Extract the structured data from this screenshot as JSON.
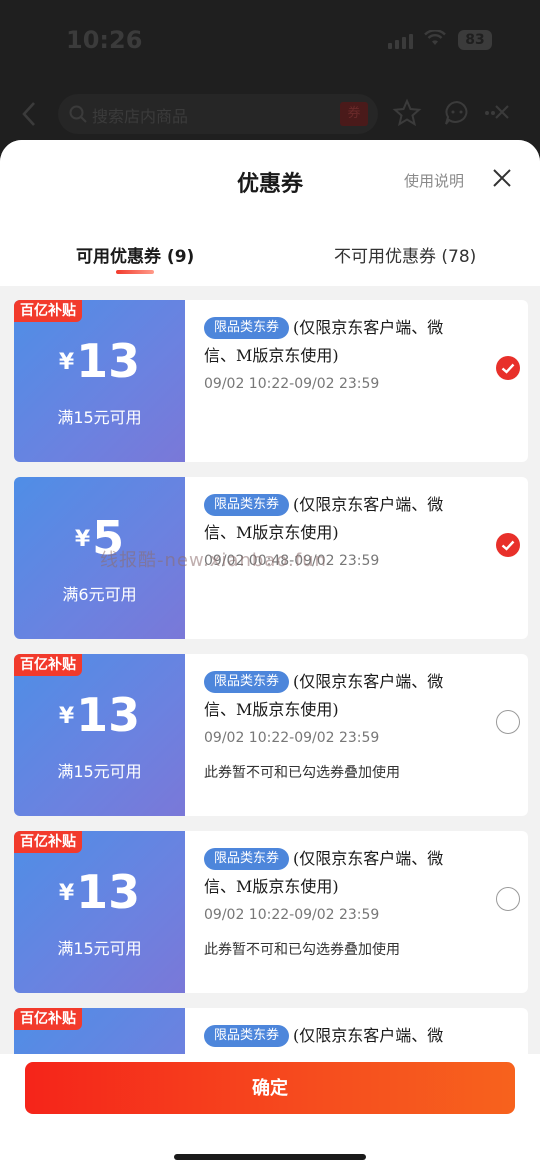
{
  "status_bar": {
    "time": "10:26",
    "battery": "83"
  },
  "background": {
    "search_placeholder": "搜索店内商品",
    "tag": "券"
  },
  "sheet": {
    "title": "优惠券",
    "help_link": "使用说明",
    "tabs": [
      {
        "label": "可用优惠券 (9)",
        "active": true
      },
      {
        "label": "不可用优惠券 (78)",
        "active": false
      }
    ]
  },
  "coupons": [
    {
      "badge": "百亿补贴",
      "currency": "¥",
      "amount": "13",
      "condition": "满15元可用",
      "tag": "限品类东券",
      "desc": "(仅限京东客户端、微信、M版京东使用)",
      "date": "09/02 10:22-09/02 23:59",
      "note": "",
      "checked": true
    },
    {
      "badge": "",
      "currency": "¥",
      "amount": "5",
      "condition": "满6元可用",
      "tag": "限品类东券",
      "desc": "(仅限京东客户端、微信、M版京东使用)",
      "date": "09/02 00:48-09/02 23:59",
      "note": "",
      "checked": true
    },
    {
      "badge": "百亿补贴",
      "currency": "¥",
      "amount": "13",
      "condition": "满15元可用",
      "tag": "限品类东券",
      "desc": "(仅限京东客户端、微信、M版京东使用)",
      "date": "09/02 10:22-09/02 23:59",
      "note": "此券暂不可和已勾选券叠加使用",
      "checked": false
    },
    {
      "badge": "百亿补贴",
      "currency": "¥",
      "amount": "13",
      "condition": "满15元可用",
      "tag": "限品类东券",
      "desc": "(仅限京东客户端、微信、M版京东使用)",
      "date": "09/02 10:22-09/02 23:59",
      "note": "此券暂不可和已勾选券叠加使用",
      "checked": false
    },
    {
      "badge": "百亿补贴",
      "currency": "",
      "amount": "",
      "condition": "",
      "tag": "限品类东券",
      "desc": "(仅限京东客户端、微",
      "date": "",
      "note": "",
      "checked": false
    }
  ],
  "watermark": "线报酷-new.xianbao.fun",
  "confirm_label": "确定",
  "colors": {
    "accent": "#f23a2c",
    "coupon_blue": "#5b88e2",
    "tag_blue": "#4d86db"
  }
}
